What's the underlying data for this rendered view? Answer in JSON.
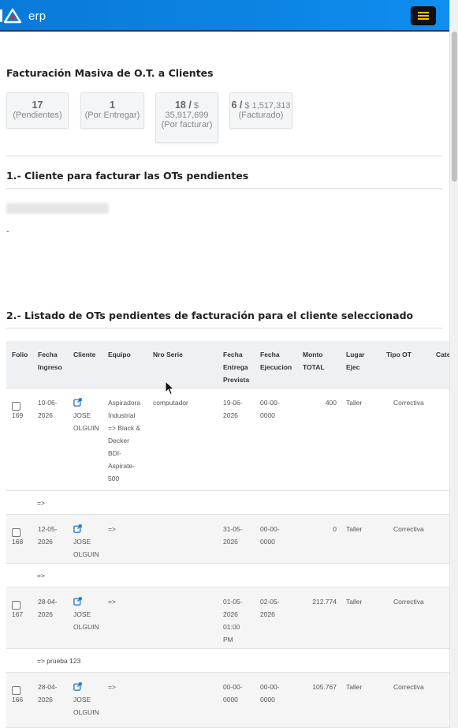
{
  "app": {
    "logo_text": "erp"
  },
  "page": {
    "title": "Facturación Masiva de O.T. a Clientes"
  },
  "stats": [
    {
      "num": "17",
      "label": "(Pendientes)"
    },
    {
      "num": "1",
      "label": "(Por Entregar)"
    },
    {
      "num": "18 /",
      "money": "$",
      "amount": "35,917,699",
      "label": "(Por facturar)"
    },
    {
      "num": "6 /",
      "money": "$ 1,517,313",
      "label": "(Facturado)"
    }
  ],
  "section1": {
    "title": "1.- Cliente para facturar las OTs pendientes",
    "dash": "-"
  },
  "section2": {
    "title": "2.- Listado de OTs pendientes de facturación para el cliente seleccionado"
  },
  "table": {
    "headers": {
      "folio": "Folio",
      "fecha_ingreso": [
        "Fecha",
        "Ingreso"
      ],
      "cliente": "Cliente",
      "equipo": "Equipo",
      "nro_serie": "Nro Serie",
      "fecha_entrega": [
        "Fecha",
        "Entrega",
        "Prevista"
      ],
      "fecha_ejecucion": [
        "Fecha",
        "Ejecucion"
      ],
      "monto": [
        "Monto",
        "TOTAL"
      ],
      "lugar": [
        "Lugar",
        "Ejec"
      ],
      "tipo": "Tipo OT",
      "cat": "Cate"
    },
    "rows": [
      {
        "folio": "169",
        "fecha_ingreso": [
          "10-06-",
          "2026"
        ],
        "cliente": [
          "JOSE",
          "OLGUIN"
        ],
        "equipo": [
          "Aspiradora",
          "Industrial",
          "=> Black &",
          "Decker",
          "BDI-",
          "Aspirate-",
          "500"
        ],
        "nro_serie": "computador",
        "fecha_entrega": [
          "19-06-",
          "2026"
        ],
        "fecha_ejecucion": [
          "00-00-",
          "0000"
        ],
        "monto": "400",
        "lugar": "Taller",
        "tipo": "Correctiva",
        "note": "=>"
      },
      {
        "folio": "168",
        "fecha_ingreso": [
          "12-05-",
          "2026"
        ],
        "cliente": [
          "JOSE",
          "OLGUIN"
        ],
        "equipo": [
          "=>"
        ],
        "nro_serie": "",
        "fecha_entrega": [
          "31-05-",
          "2026"
        ],
        "fecha_ejecucion": [
          "00-00-",
          "0000"
        ],
        "monto": "0",
        "lugar": "Taller",
        "tipo": "Correctiva",
        "note": "=>"
      },
      {
        "folio": "167",
        "fecha_ingreso": [
          "28-04-",
          "2026"
        ],
        "cliente": [
          "JOSE",
          "OLGUIN"
        ],
        "equipo": [
          "=>"
        ],
        "nro_serie": "",
        "fecha_entrega": [
          "01-05-",
          "2026",
          "01:00",
          "PM"
        ],
        "fecha_ejecucion": [
          "02-05-",
          "2026"
        ],
        "monto": "212.774",
        "lugar": "Taller",
        "tipo": "Correctiva",
        "note": "=> prueba 123"
      },
      {
        "folio": "166",
        "fecha_ingreso": [
          "28-04-",
          "2026"
        ],
        "cliente": [
          "JOSE",
          "OLGUIN"
        ],
        "equipo": [
          "=>"
        ],
        "nro_serie": "",
        "fecha_entrega": [
          "00-00-",
          "0000"
        ],
        "fecha_ejecucion": [
          "00-00-",
          "0000"
        ],
        "monto": "105.767",
        "lugar": "Taller",
        "tipo": "Correctiva",
        "note": ""
      }
    ]
  },
  "colors": {
    "navbar": "#0c84e4",
    "link_icon": "#1a73c9",
    "menu_bars": "#f5c400"
  }
}
